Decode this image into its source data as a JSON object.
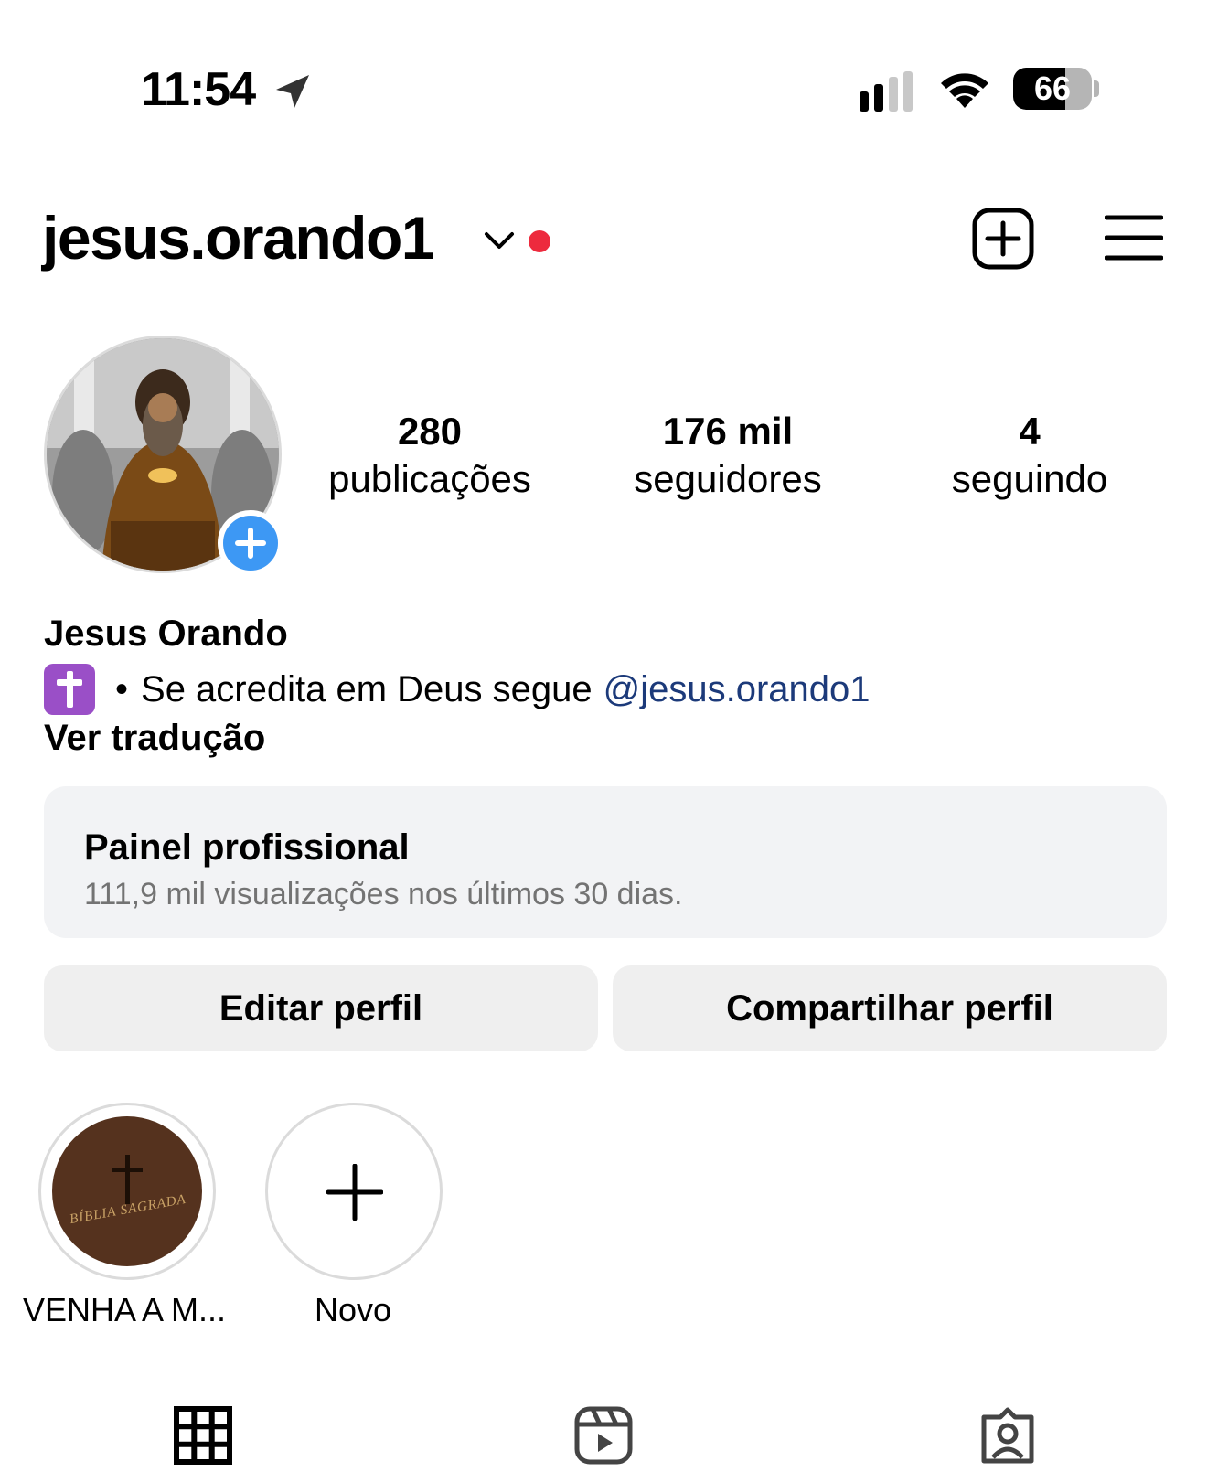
{
  "status_bar": {
    "time": "11:54",
    "battery": "66",
    "battery_level": 0.66,
    "icons": [
      "location-arrow-icon",
      "signal-icon",
      "wifi-icon",
      "battery-icon"
    ]
  },
  "header": {
    "username": "jesus.orando1",
    "notification_dot_color": "#ed2a3d",
    "icons": [
      "chevron-down-icon",
      "new-post-icon",
      "menu-icon"
    ]
  },
  "profile": {
    "stats": [
      {
        "value": "280",
        "label": "publicações"
      },
      {
        "value": "176 mil",
        "label": "seguidores"
      },
      {
        "value": "4",
        "label": "seguindo"
      }
    ],
    "full_name": "Jesus Orando",
    "bio_separator": "•",
    "bio_text": "Se acredita em Deus segue",
    "bio_mention": "@jesus.orando1",
    "translate_label": "Ver tradução"
  },
  "dashboard": {
    "title": "Painel profissional",
    "subtitle": "111,9 mil visualizações nos últimos 30 dias."
  },
  "buttons": {
    "edit": "Editar perfil",
    "share": "Compartilhar perfil"
  },
  "highlights": [
    {
      "label": "VENHA A M...",
      "cover_text": "BÍBLIA SAGRADA"
    },
    {
      "label": "Novo"
    }
  ],
  "tabs": [
    "grid-icon",
    "reels-icon",
    "tagged-icon"
  ],
  "colors": {
    "accent_blue": "#3d98f4",
    "mention": "#1c3a7a",
    "panel_bg": "#f2f3f5",
    "button_bg": "#efefef"
  }
}
